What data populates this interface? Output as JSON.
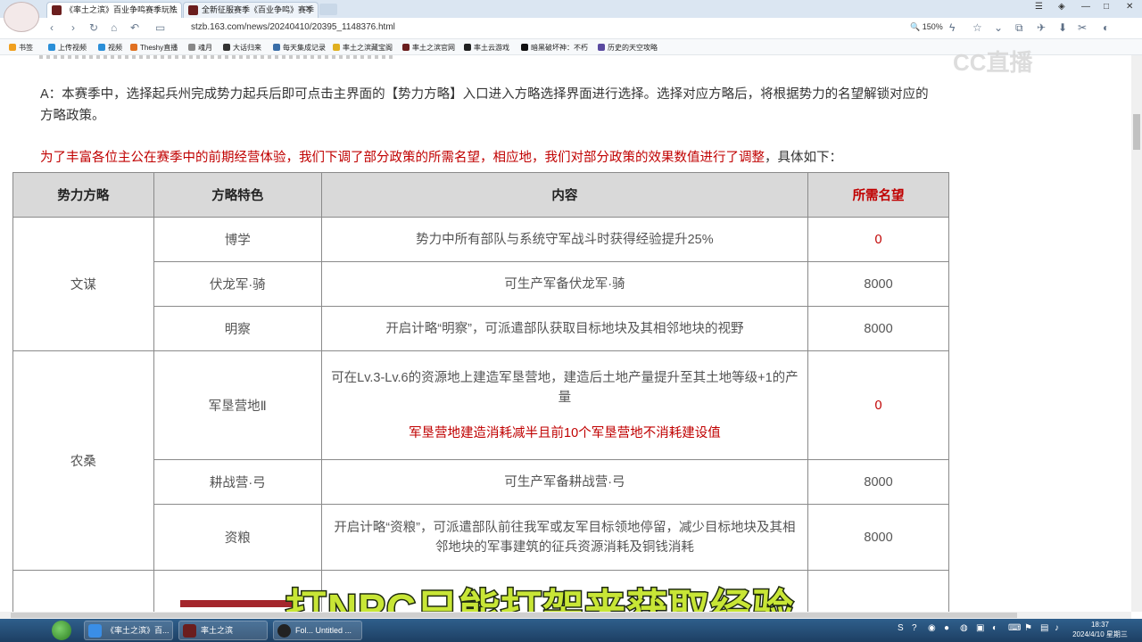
{
  "browser": {
    "tabs": [
      {
        "label": "《率土之滨》百业争鸣赛季玩法",
        "active": true
      },
      {
        "label": "全新征服赛季《百业争鸣》赛季",
        "active": false
      }
    ],
    "url": "stzb.163.com/news/20240410/20395_1148376.html",
    "zoom": "150%",
    "bookmarks": [
      "书签",
      "上传视频",
      "视频",
      "Theshy直播",
      "魂月",
      "大话归来",
      "每天集成记录",
      "率土之滨藏宝阁",
      "率土之滨官网",
      "率土云游戏",
      "暗黑破坏神：不朽",
      "历史的天空攻略"
    ]
  },
  "article": {
    "answer": "A：本赛季中，选择起兵州完成势力起兵后即可点击主界面的【势力方略】入口进入方略选择界面进行选择。选择对应方略后，将根据势力的名望解锁对应的方略政策。",
    "red_lead": "为了丰富各位主公在赛季中的前期经营体验，我们下调了部分政策的所需名望，相应地，我们对部分政策的效果数值进行了调整",
    "red_tail": "，具体如下：",
    "table": {
      "headers": [
        "势力方略",
        "方略特色",
        "内容",
        "所需名望"
      ],
      "groups": [
        {
          "name": "文谋",
          "rows": [
            {
              "feature": "博学",
              "content": "势力中所有部队与系统守军战斗时获得经验提升25%",
              "value": "0",
              "value_red": true
            },
            {
              "feature": "伏龙军·骑",
              "content": "可生产军备伏龙军·骑",
              "value": "8000",
              "value_red": false
            },
            {
              "feature": "明察",
              "content": "开启计略“明察”，可派遣部队获取目标地块及其相邻地块的视野",
              "value": "8000",
              "value_red": false
            }
          ]
        },
        {
          "name": "农桑",
          "rows": [
            {
              "feature": "军垦营地Ⅱ",
              "content": "可在Lv.3-Lv.6的资源地上建造军垦营地，建造后土地产量提升至其土地等级+1的产量",
              "note": "军垦营地建造消耗减半且前10个军垦营地不消耗建设值",
              "value": "0",
              "value_red": true
            },
            {
              "feature": "耕战营·弓",
              "content": "可生产军备耕战营·弓",
              "value": "8000",
              "value_red": false
            },
            {
              "feature": "资粮",
              "content": "开启计略“资粮”，可派遣部队前往我军或友军目标领地停留，减少目标地块及其相邻地块的军事建筑的征兵资源消耗及铜钱消耗",
              "value": "8000",
              "value_red": false
            }
          ]
        }
      ]
    }
  },
  "subtitle": "打NPC只能打架来获取经验",
  "watermark": "CC直播",
  "taskbar": {
    "tasks": [
      "《率土之滨》百...",
      "率土之滨",
      "Fol... Untitled ..."
    ],
    "time": "18:37",
    "date": "2024/4/10 星期三"
  }
}
